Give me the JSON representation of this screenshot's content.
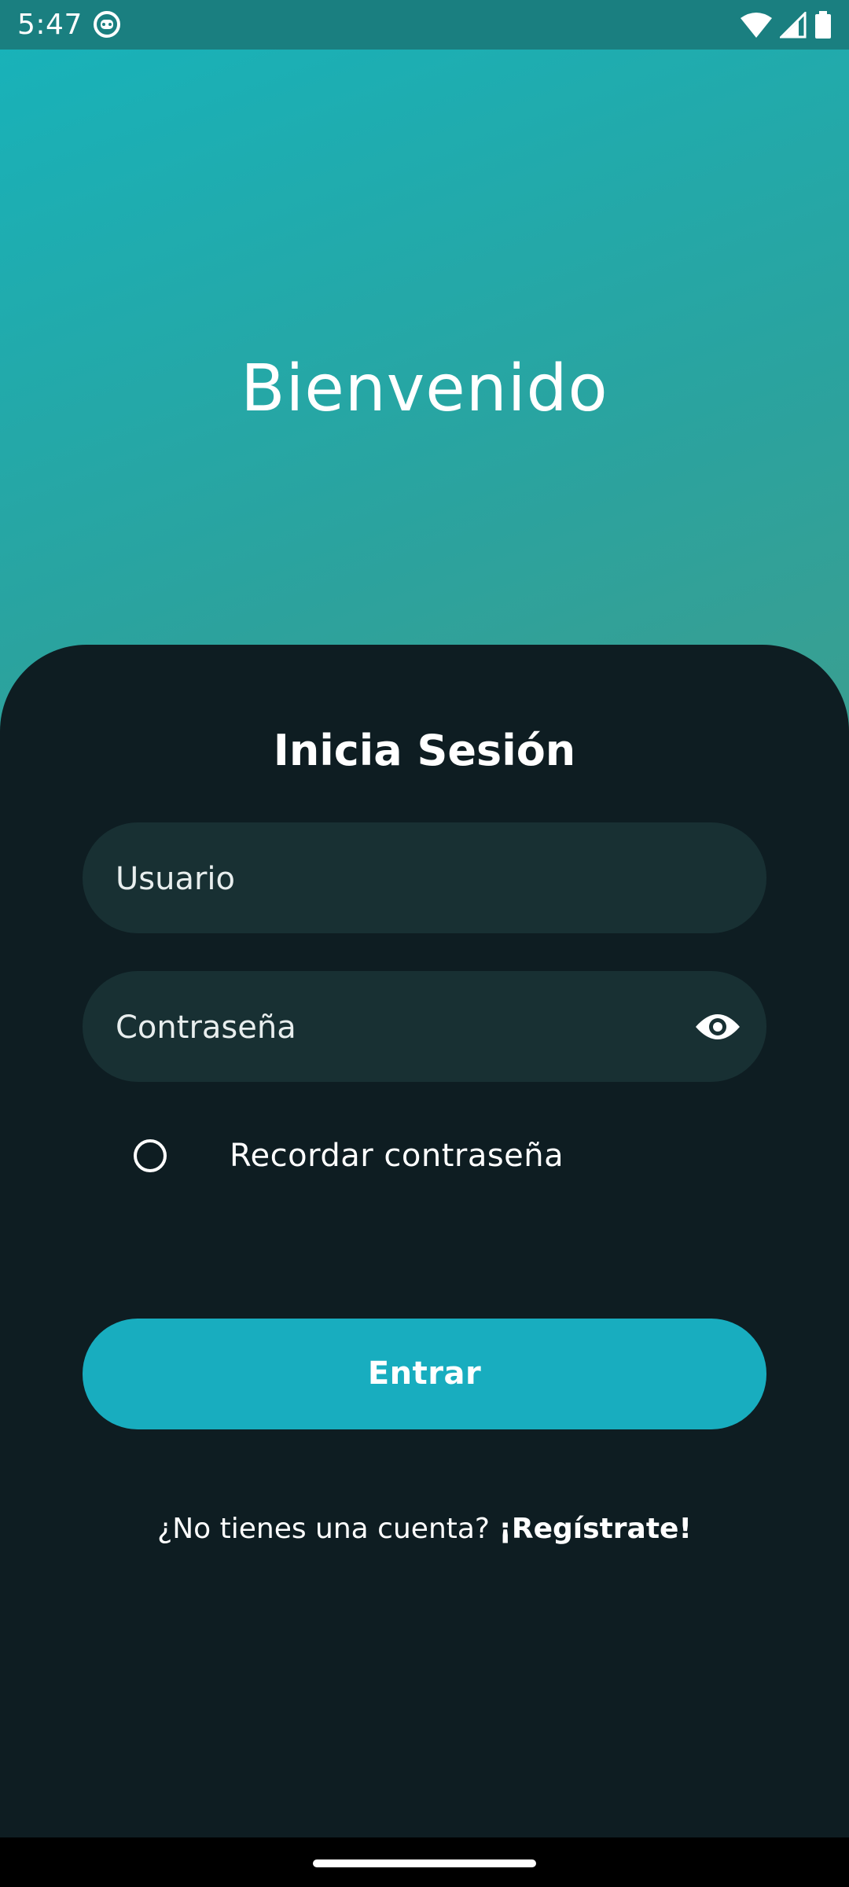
{
  "status_bar": {
    "time": "5:47",
    "icons": [
      "app-notification-icon",
      "wifi-icon",
      "cellular-signal-icon",
      "battery-icon"
    ]
  },
  "welcome": {
    "title": "Bienvenido"
  },
  "login": {
    "title": "Inicia Sesión",
    "username_placeholder": "Usuario",
    "password_placeholder": "Contraseña",
    "password_toggle_icon": "eye-icon",
    "remember_label": "Recordar contraseña",
    "remember_checked": false,
    "submit_label": "Entrar",
    "register_prompt": "¿No tienes una cuenta?",
    "register_link": "¡Regístrate!"
  },
  "colors": {
    "gradient_start": "#17b3bb",
    "gradient_end": "#5c9a74",
    "card_background": "#0e1d22",
    "field_background": "#183033",
    "accent_button": "#18adbf",
    "status_bar": "#1a7f80"
  }
}
